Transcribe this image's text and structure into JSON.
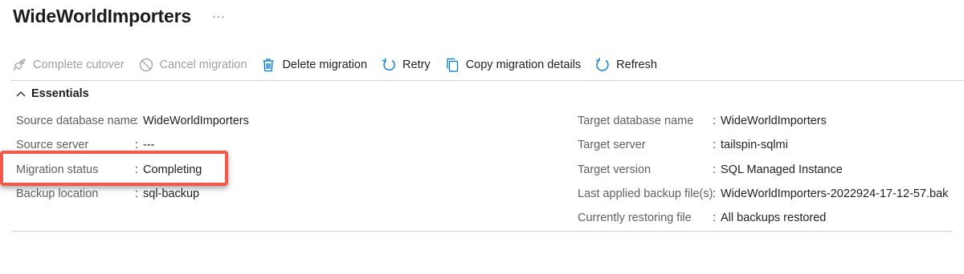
{
  "header": {
    "title": "WideWorldImporters",
    "more_label": "···"
  },
  "toolbar": {
    "complete_cutover": {
      "label": "Complete cutover",
      "icon": "rocket-icon",
      "enabled": false
    },
    "cancel_migration": {
      "label": "Cancel migration",
      "icon": "cancel-icon",
      "enabled": false
    },
    "delete_migration": {
      "label": "Delete migration",
      "icon": "trash-icon",
      "enabled": true
    },
    "retry": {
      "label": "Retry",
      "icon": "retry-icon",
      "enabled": true
    },
    "copy_details": {
      "label": "Copy migration details",
      "icon": "copy-icon",
      "enabled": true
    },
    "refresh": {
      "label": "Refresh",
      "icon": "refresh-icon",
      "enabled": true
    }
  },
  "essentials": {
    "label": "Essentials",
    "expanded": true,
    "left": [
      {
        "label": "Source database name",
        "value": "WideWorldImporters"
      },
      {
        "label": "Source server",
        "value": "---"
      },
      {
        "label": "Migration status",
        "value": "Completing"
      },
      {
        "label": "Backup location",
        "value": "sql-backup"
      }
    ],
    "right": [
      {
        "label": "Target database name",
        "value": "WideWorldImporters"
      },
      {
        "label": "Target server",
        "value": "tailspin-sqlmi"
      },
      {
        "label": "Target version",
        "value": "SQL Managed Instance"
      },
      {
        "label": "Last applied backup file(s)",
        "value": "WideWorldImporters-2022924-17-12-57.bak"
      },
      {
        "label": "Currently restoring file",
        "value": "All backups restored"
      }
    ]
  },
  "colors": {
    "accent": "#0078d4",
    "highlight_border": "#f1594a",
    "disabled_text": "#a19f9d"
  },
  "separator": ":"
}
